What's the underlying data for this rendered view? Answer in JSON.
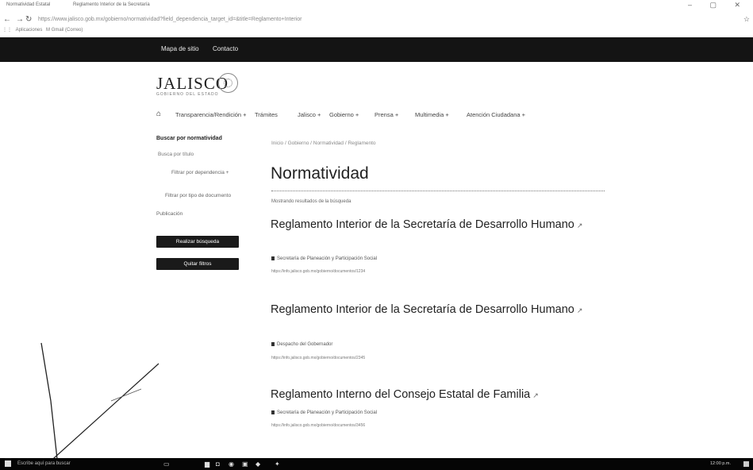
{
  "browser": {
    "tabs": [
      "Normatividad Estatal",
      "Reglamento Interior de la Secretaría"
    ],
    "window_controls": "– ▢ ✕",
    "url": "https://www.jalisco.gob.mx/gobierno/normatividad?field_dependencia_target_id=&title=Reglamento+Interior",
    "bookmarks": [
      "Aplicaciones",
      "M Gmail (Correo)"
    ]
  },
  "topbar": {
    "links": [
      "Mapa de sitio",
      "Contacto"
    ]
  },
  "logo": {
    "text": "JALISCO",
    "subtitle": "GOBIERNO DEL ESTADO"
  },
  "mainnav": {
    "items": [
      "Transparencia/Rendición +",
      "Trámites",
      "Jalisco +",
      "Gobierno +",
      "Prensa +",
      "Multimedia +",
      "Atención Ciudadana +"
    ]
  },
  "sidebar": {
    "title": "Buscar por normatividad",
    "search_placeholder": "Busca por título",
    "filter_dependency": "Filtrar por dependencia +",
    "filter_type": "Filtrar por tipo de documento",
    "label_year": "Publicación",
    "search_button": "Realizar búsqueda",
    "clear_button": "Quitar filtros"
  },
  "content": {
    "breadcrumb": "Inicio / Gobierno / Normatividad / Reglamento",
    "title": "Normatividad",
    "result_count": "Mostrando resultados de la búsqueda",
    "results": [
      {
        "title": "Reglamento Interior de la Secretaría de Desarrollo Humano",
        "dependency": "Secretaría de Planeación y Participación Social",
        "url": "https://info.jalisco.gob.mx/gobierno/documentos/1234"
      },
      {
        "title": "Reglamento Interior de la Secretaría de Desarrollo Humano",
        "dependency": "Despacho del Gobernador",
        "url": "https://info.jalisco.gob.mx/gobierno/documentos/2345"
      },
      {
        "title": "Reglamento Interno del Consejo Estatal de Familia",
        "dependency": "Secretaría de Planeación y Participación Social",
        "url": "https://info.jalisco.gob.mx/gobierno/documentos/3456"
      }
    ],
    "external_icon": "external-link-icon"
  },
  "taskbar": {
    "search_placeholder": "Escribe aquí para buscar",
    "clock": "12:00 p.m."
  }
}
